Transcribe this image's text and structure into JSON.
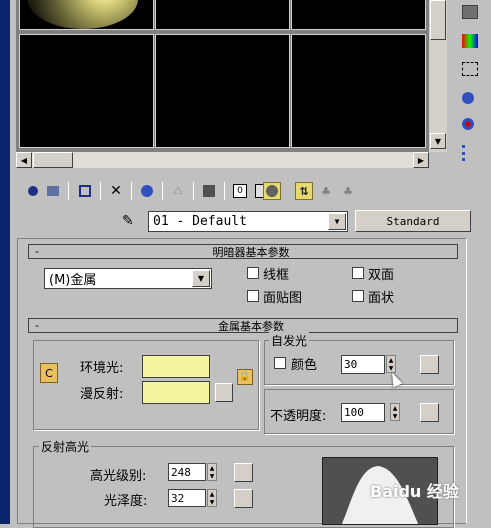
{
  "material_slots": {
    "count": 6,
    "scroll_up": "▲",
    "scroll_down": "▼",
    "scroll_left": "◀",
    "scroll_right": "▶"
  },
  "side_toolbar": {
    "icons": [
      "sample-type-icon",
      "backlight-icon",
      "background-icon",
      "sample-uv-icon",
      "video-check-icon",
      "make-preview-icon",
      "options-icon"
    ]
  },
  "toolbar": {
    "icons": [
      "get-material-icon",
      "put-to-scene-icon",
      "assign-material-icon",
      "reset-icon",
      "make-copy-icon",
      "make-unique-icon",
      "put-to-library-icon",
      "material-id-icon",
      "show-map-icon",
      "show-end-result-icon",
      "go-to-parent-icon",
      "go-forward-icon"
    ]
  },
  "material_name": {
    "value": "01 - Default",
    "type_button": "Standard"
  },
  "shader_basic": {
    "title": "明暗器基本参数",
    "collapse": "-",
    "shader_value": "(M)金属",
    "wire": "线框",
    "two_sided": "双面",
    "face_map": "面贴图",
    "faceted": "面状"
  },
  "metal_basic": {
    "title": "金属基本参数",
    "collapse": "-",
    "lock_glyph": "C",
    "ambient_label": "环境光:",
    "diffuse_label": "漫反射:",
    "swatch_color": "#f4f4a0",
    "self_illum_label": "自发光",
    "color_label": "颜色",
    "self_illum_value": "30",
    "opacity_label": "不透明度:",
    "opacity_value": "100"
  },
  "specular": {
    "title": "反射高光",
    "level_label": "高光级别:",
    "level_value": "248",
    "gloss_label": "光泽度:",
    "gloss_value": "32"
  },
  "watermark": "Baidu 经验"
}
